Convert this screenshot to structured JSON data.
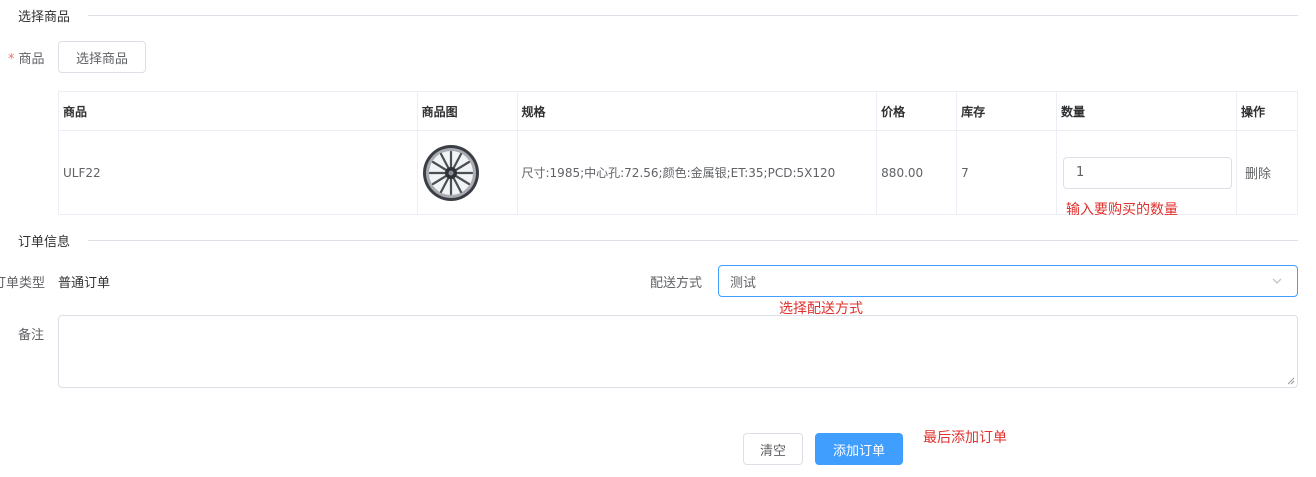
{
  "sections": {
    "product": "选择商品",
    "order_info": "订单信息"
  },
  "product_field": {
    "label": "商品",
    "button": "选择商品"
  },
  "table": {
    "columns": [
      "商品",
      "商品图",
      "规格",
      "价格",
      "库存",
      "数量",
      "操作"
    ],
    "rows": [
      {
        "name": "ULF22",
        "spec": "尺寸:1985;中心孔:72.56;颜色:金属银;ET:35;PCD:5X120",
        "price": "880.00",
        "stock": "7",
        "quantity": "1",
        "action": "删除"
      }
    ]
  },
  "order": {
    "type_label": "订单类型",
    "type_value": "普通订单",
    "delivery_label": "配送方式",
    "delivery_value": "测试",
    "remark_label": "备注"
  },
  "buttons": {
    "clear": "清空",
    "submit": "添加订单"
  },
  "annotations": {
    "quantity": "输入要购买的数量",
    "delivery": "选择配送方式",
    "submit": "最后添加订单"
  },
  "colors": {
    "primary": "#409eff",
    "annotation": "#e0312e",
    "required": "#f56c6c"
  }
}
